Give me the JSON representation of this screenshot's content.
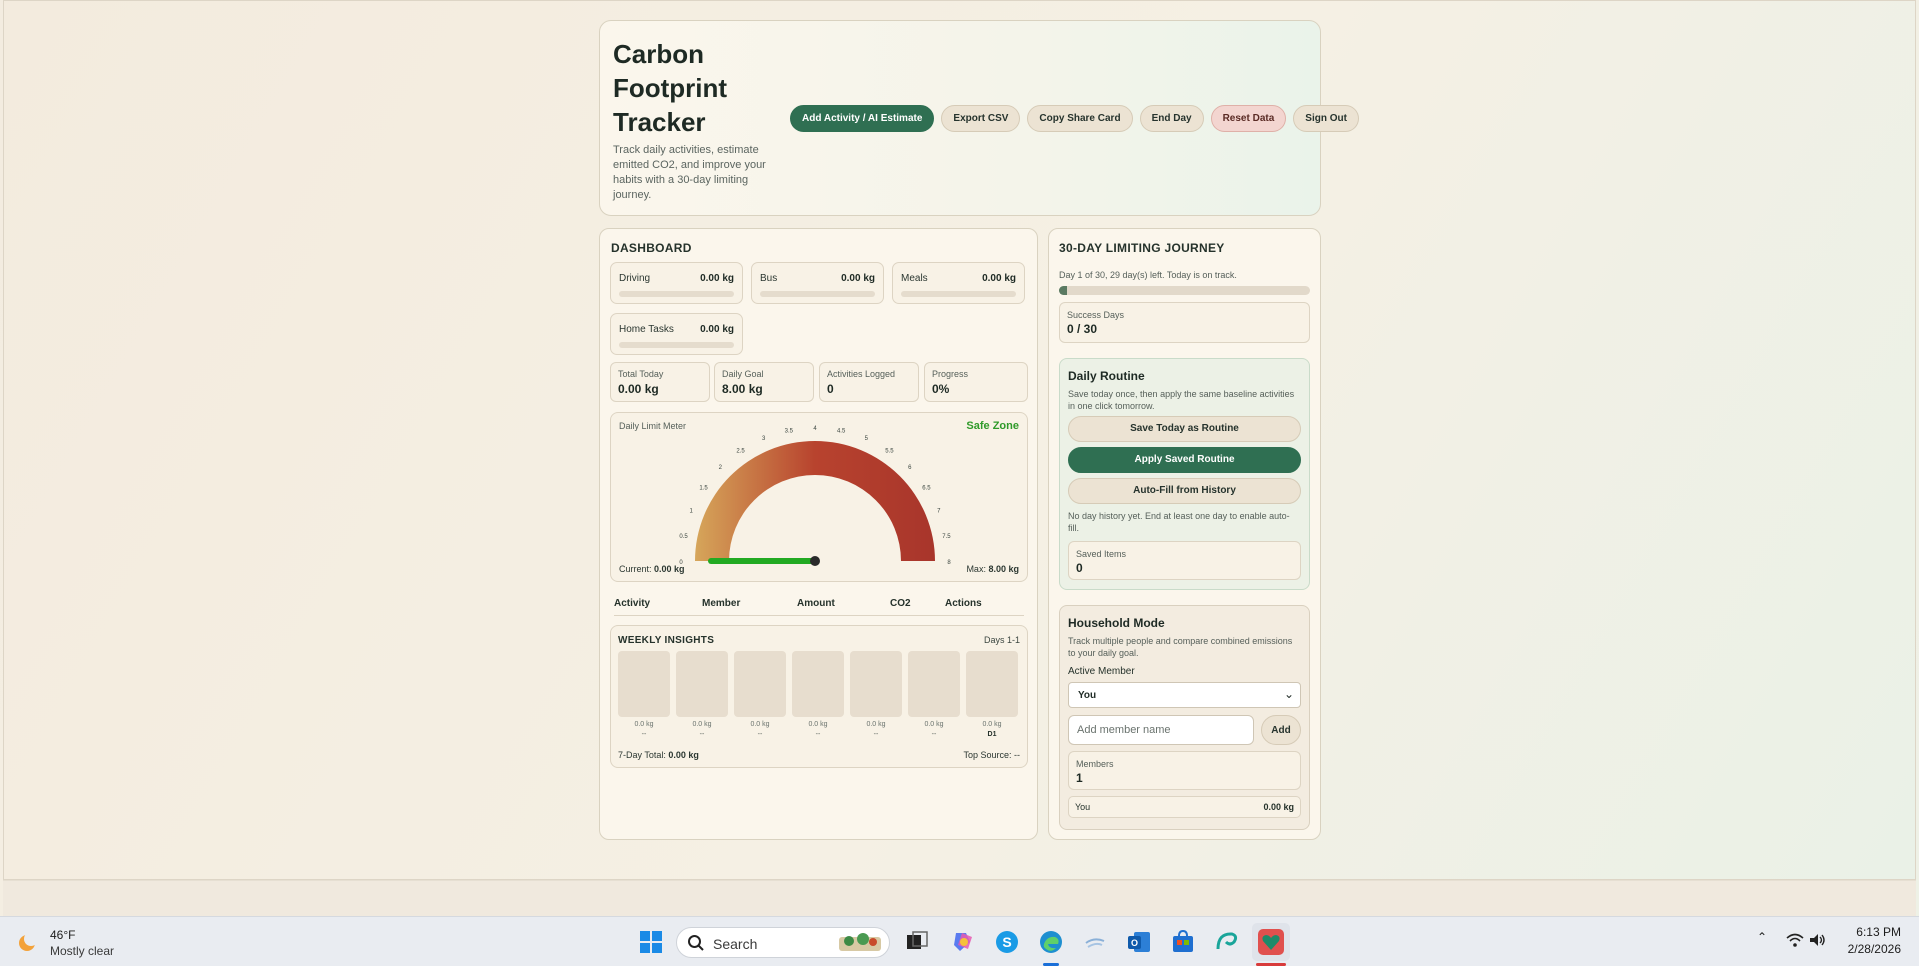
{
  "header": {
    "title": "Carbon Footprint Tracker",
    "subtitle": "Track daily activities, estimate emitted CO2, and improve your habits with a 30-day limiting journey.",
    "buttons": {
      "add": "Add Activity / AI Estimate",
      "export": "Export CSV",
      "share": "Copy Share Card",
      "end_day": "End Day",
      "reset": "Reset Data",
      "sign_out": "Sign Out"
    }
  },
  "dashboard": {
    "title": "DASHBOARD",
    "categories": [
      {
        "name": "Driving",
        "value": "0.00 kg",
        "progress": 0
      },
      {
        "name": "Bus",
        "value": "0.00 kg",
        "progress": 0
      },
      {
        "name": "Meals",
        "value": "0.00 kg",
        "progress": 0
      },
      {
        "name": "Home Tasks",
        "value": "0.00 kg",
        "progress": 0
      }
    ],
    "stats": [
      {
        "label": "Total Today",
        "value": "0.00 kg"
      },
      {
        "label": "Daily Goal",
        "value": "8.00 kg"
      },
      {
        "label": "Activities Logged",
        "value": "0"
      },
      {
        "label": "Progress",
        "value": "0%"
      }
    ],
    "meter": {
      "label": "Daily Limit Meter",
      "status": "Safe Zone",
      "current_label": "Current:",
      "current_value": "0.00 kg",
      "max_label": "Max:",
      "max_value": "8.00 kg",
      "current": 0,
      "max": 8,
      "ticks": [
        "0",
        "0.5",
        "1",
        "1.5",
        "2",
        "2.5",
        "3",
        "3.5",
        "4",
        "4.5",
        "5",
        "5.5",
        "6",
        "6.5",
        "7",
        "7.5",
        "8"
      ],
      "colors": {
        "low": "#d6a65a",
        "mid": "#b8432e",
        "high": "#a8352b",
        "needle": "#22aa22"
      }
    },
    "table_headers": {
      "activity": "Activity",
      "member": "Member",
      "amount": "Amount",
      "co2": "CO2",
      "actions": "Actions"
    },
    "weekly": {
      "title": "WEEKLY INSIGHTS",
      "range": "Days 1-1",
      "days": [
        {
          "value": "0.0 kg",
          "label": "--"
        },
        {
          "value": "0.0 kg",
          "label": "--"
        },
        {
          "value": "0.0 kg",
          "label": "--"
        },
        {
          "value": "0.0 kg",
          "label": "--"
        },
        {
          "value": "0.0 kg",
          "label": "--"
        },
        {
          "value": "0.0 kg",
          "label": "--"
        },
        {
          "value": "0.0 kg",
          "label": "D1"
        }
      ],
      "total_label": "7-Day Total:",
      "total_value": "0.00 kg",
      "top_source_label": "Top Source:",
      "top_source_value": "--"
    }
  },
  "journey": {
    "title": "30-DAY LIMITING JOURNEY",
    "note": "Day 1 of 30, 29 day(s) left. Today is on track.",
    "progress": 0.033,
    "success_label": "Success Days",
    "success_value": "0 / 30",
    "routine": {
      "title": "Daily Routine",
      "desc": "Save today once, then apply the same baseline activities in one click tomorrow.",
      "save_btn": "Save Today as Routine",
      "apply_btn": "Apply Saved Routine",
      "autofill_btn": "Auto-Fill from History",
      "history_note": "No day history yet. End at least one day to enable auto-fill.",
      "saved_label": "Saved Items",
      "saved_value": "0"
    },
    "household": {
      "title": "Household Mode",
      "desc": "Track multiple people and compare combined emissions to your daily goal.",
      "active_label": "Active Member",
      "active_value": "You",
      "input_placeholder": "Add member name",
      "add_btn": "Add",
      "members_label": "Members",
      "members_value": "1",
      "member_rows": [
        {
          "name": "You",
          "amount": "0.00 kg"
        }
      ]
    }
  },
  "taskbar": {
    "weather_temp": "46°F",
    "weather_desc": "Mostly clear",
    "search_placeholder": "Search",
    "time": "6:13 PM",
    "date": "2/28/2026",
    "icons": [
      "start-icon",
      "search-icon",
      "task-view-icon",
      "copilot-icon",
      "skype-icon",
      "edge-icon",
      "app-icon",
      "outlook-icon",
      "store-icon",
      "app-swirl-icon",
      "app-heart-icon",
      "wifi-icon",
      "volume-icon"
    ]
  }
}
